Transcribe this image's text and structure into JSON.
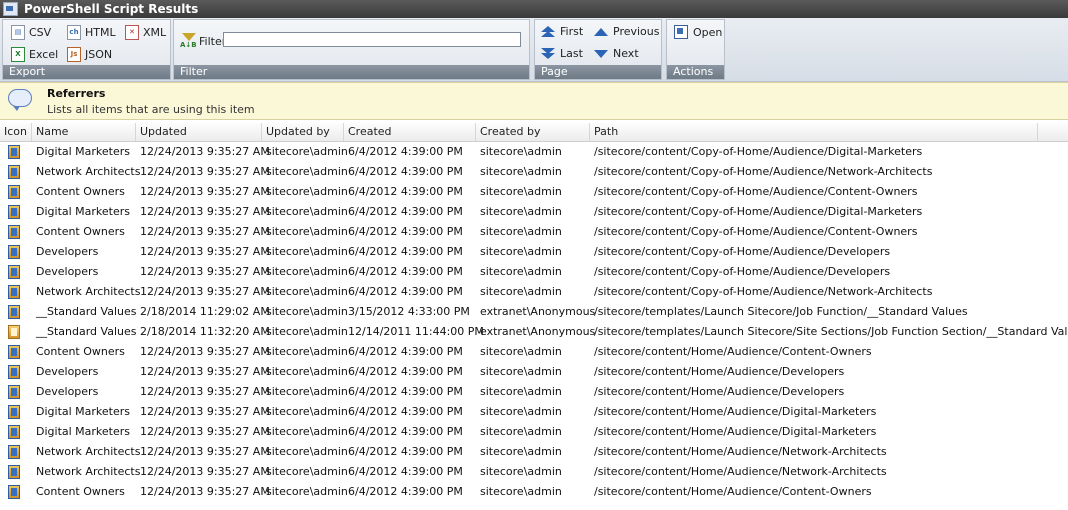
{
  "window": {
    "title": "PowerShell Script Results"
  },
  "ribbon": {
    "export": {
      "label": "Export",
      "buttons": {
        "csv": "CSV",
        "html": "HTML",
        "xml": "XML",
        "excel": "Excel",
        "json": "JSON"
      }
    },
    "filter": {
      "group_label": "Filter",
      "button_label": "Filter",
      "value": ""
    },
    "page": {
      "label": "Page",
      "first": "First",
      "last": "Last",
      "previous": "Previous",
      "next": "Next"
    },
    "actions": {
      "label": "Actions",
      "open": "Open"
    }
  },
  "banner": {
    "title": "Referrers",
    "description": "Lists all items that are using this item"
  },
  "table": {
    "columns": [
      "Icon",
      "Name",
      "Updated",
      "Updated by",
      "Created",
      "Created by",
      "Path"
    ],
    "rows": [
      {
        "icon": "item-icon",
        "name": "Digital Marketers",
        "updated": "12/24/2013 9:35:27 AM",
        "updated_by": "sitecore\\admin",
        "created": "6/4/2012 4:39:00 PM",
        "created_by": "sitecore\\admin",
        "path": "/sitecore/content/Copy-of-Home/Audience/Digital-Marketers"
      },
      {
        "icon": "item-icon",
        "name": "Network Architects",
        "updated": "12/24/2013 9:35:27 AM",
        "updated_by": "sitecore\\admin",
        "created": "6/4/2012 4:39:00 PM",
        "created_by": "sitecore\\admin",
        "path": "/sitecore/content/Copy-of-Home/Audience/Network-Architects"
      },
      {
        "icon": "item-icon",
        "name": "Content Owners",
        "updated": "12/24/2013 9:35:27 AM",
        "updated_by": "sitecore\\admin",
        "created": "6/4/2012 4:39:00 PM",
        "created_by": "sitecore\\admin",
        "path": "/sitecore/content/Copy-of-Home/Audience/Content-Owners"
      },
      {
        "icon": "item-icon",
        "name": "Digital Marketers",
        "updated": "12/24/2013 9:35:27 AM",
        "updated_by": "sitecore\\admin",
        "created": "6/4/2012 4:39:00 PM",
        "created_by": "sitecore\\admin",
        "path": "/sitecore/content/Copy-of-Home/Audience/Digital-Marketers"
      },
      {
        "icon": "item-icon",
        "name": "Content Owners",
        "updated": "12/24/2013 9:35:27 AM",
        "updated_by": "sitecore\\admin",
        "created": "6/4/2012 4:39:00 PM",
        "created_by": "sitecore\\admin",
        "path": "/sitecore/content/Copy-of-Home/Audience/Content-Owners"
      },
      {
        "icon": "item-icon",
        "name": "Developers",
        "updated": "12/24/2013 9:35:27 AM",
        "updated_by": "sitecore\\admin",
        "created": "6/4/2012 4:39:00 PM",
        "created_by": "sitecore\\admin",
        "path": "/sitecore/content/Copy-of-Home/Audience/Developers"
      },
      {
        "icon": "item-icon",
        "name": "Developers",
        "updated": "12/24/2013 9:35:27 AM",
        "updated_by": "sitecore\\admin",
        "created": "6/4/2012 4:39:00 PM",
        "created_by": "sitecore\\admin",
        "path": "/sitecore/content/Copy-of-Home/Audience/Developers"
      },
      {
        "icon": "item-icon",
        "name": "Network Architects",
        "updated": "12/24/2013 9:35:27 AM",
        "updated_by": "sitecore\\admin",
        "created": "6/4/2012 4:39:00 PM",
        "created_by": "sitecore\\admin",
        "path": "/sitecore/content/Copy-of-Home/Audience/Network-Architects"
      },
      {
        "icon": "item-icon",
        "name": "__Standard Values",
        "updated": "2/18/2014 11:29:02 AM",
        "updated_by": "sitecore\\admin",
        "created": "3/15/2012 4:33:00 PM",
        "created_by": "extranet\\Anonymous",
        "path": "/sitecore/templates/Launch Sitecore/Job Function/__Standard Values"
      },
      {
        "icon": "template-icon",
        "name": "__Standard Values",
        "updated": "2/18/2014 11:32:20 AM",
        "updated_by": "sitecore\\admin",
        "created": "12/14/2011 11:44:00 PM",
        "created_by": "extranet\\Anonymous",
        "path": "/sitecore/templates/Launch Sitecore/Site Sections/Job Function Section/__Standard Values"
      },
      {
        "icon": "item-icon",
        "name": "Content Owners",
        "updated": "12/24/2013 9:35:27 AM",
        "updated_by": "sitecore\\admin",
        "created": "6/4/2012 4:39:00 PM",
        "created_by": "sitecore\\admin",
        "path": "/sitecore/content/Home/Audience/Content-Owners"
      },
      {
        "icon": "item-icon",
        "name": "Developers",
        "updated": "12/24/2013 9:35:27 AM",
        "updated_by": "sitecore\\admin",
        "created": "6/4/2012 4:39:00 PM",
        "created_by": "sitecore\\admin",
        "path": "/sitecore/content/Home/Audience/Developers"
      },
      {
        "icon": "item-icon",
        "name": "Developers",
        "updated": "12/24/2013 9:35:27 AM",
        "updated_by": "sitecore\\admin",
        "created": "6/4/2012 4:39:00 PM",
        "created_by": "sitecore\\admin",
        "path": "/sitecore/content/Home/Audience/Developers"
      },
      {
        "icon": "item-icon",
        "name": "Digital Marketers",
        "updated": "12/24/2013 9:35:27 AM",
        "updated_by": "sitecore\\admin",
        "created": "6/4/2012 4:39:00 PM",
        "created_by": "sitecore\\admin",
        "path": "/sitecore/content/Home/Audience/Digital-Marketers"
      },
      {
        "icon": "item-icon",
        "name": "Digital Marketers",
        "updated": "12/24/2013 9:35:27 AM",
        "updated_by": "sitecore\\admin",
        "created": "6/4/2012 4:39:00 PM",
        "created_by": "sitecore\\admin",
        "path": "/sitecore/content/Home/Audience/Digital-Marketers"
      },
      {
        "icon": "item-icon",
        "name": "Network Architects",
        "updated": "12/24/2013 9:35:27 AM",
        "updated_by": "sitecore\\admin",
        "created": "6/4/2012 4:39:00 PM",
        "created_by": "sitecore\\admin",
        "path": "/sitecore/content/Home/Audience/Network-Architects"
      },
      {
        "icon": "item-icon",
        "name": "Network Architects",
        "updated": "12/24/2013 9:35:27 AM",
        "updated_by": "sitecore\\admin",
        "created": "6/4/2012 4:39:00 PM",
        "created_by": "sitecore\\admin",
        "path": "/sitecore/content/Home/Audience/Network-Architects"
      },
      {
        "icon": "item-icon",
        "name": "Content Owners",
        "updated": "12/24/2013 9:35:27 AM",
        "updated_by": "sitecore\\admin",
        "created": "6/4/2012 4:39:00 PM",
        "created_by": "sitecore\\admin",
        "path": "/sitecore/content/Home/Audience/Content-Owners"
      }
    ]
  }
}
